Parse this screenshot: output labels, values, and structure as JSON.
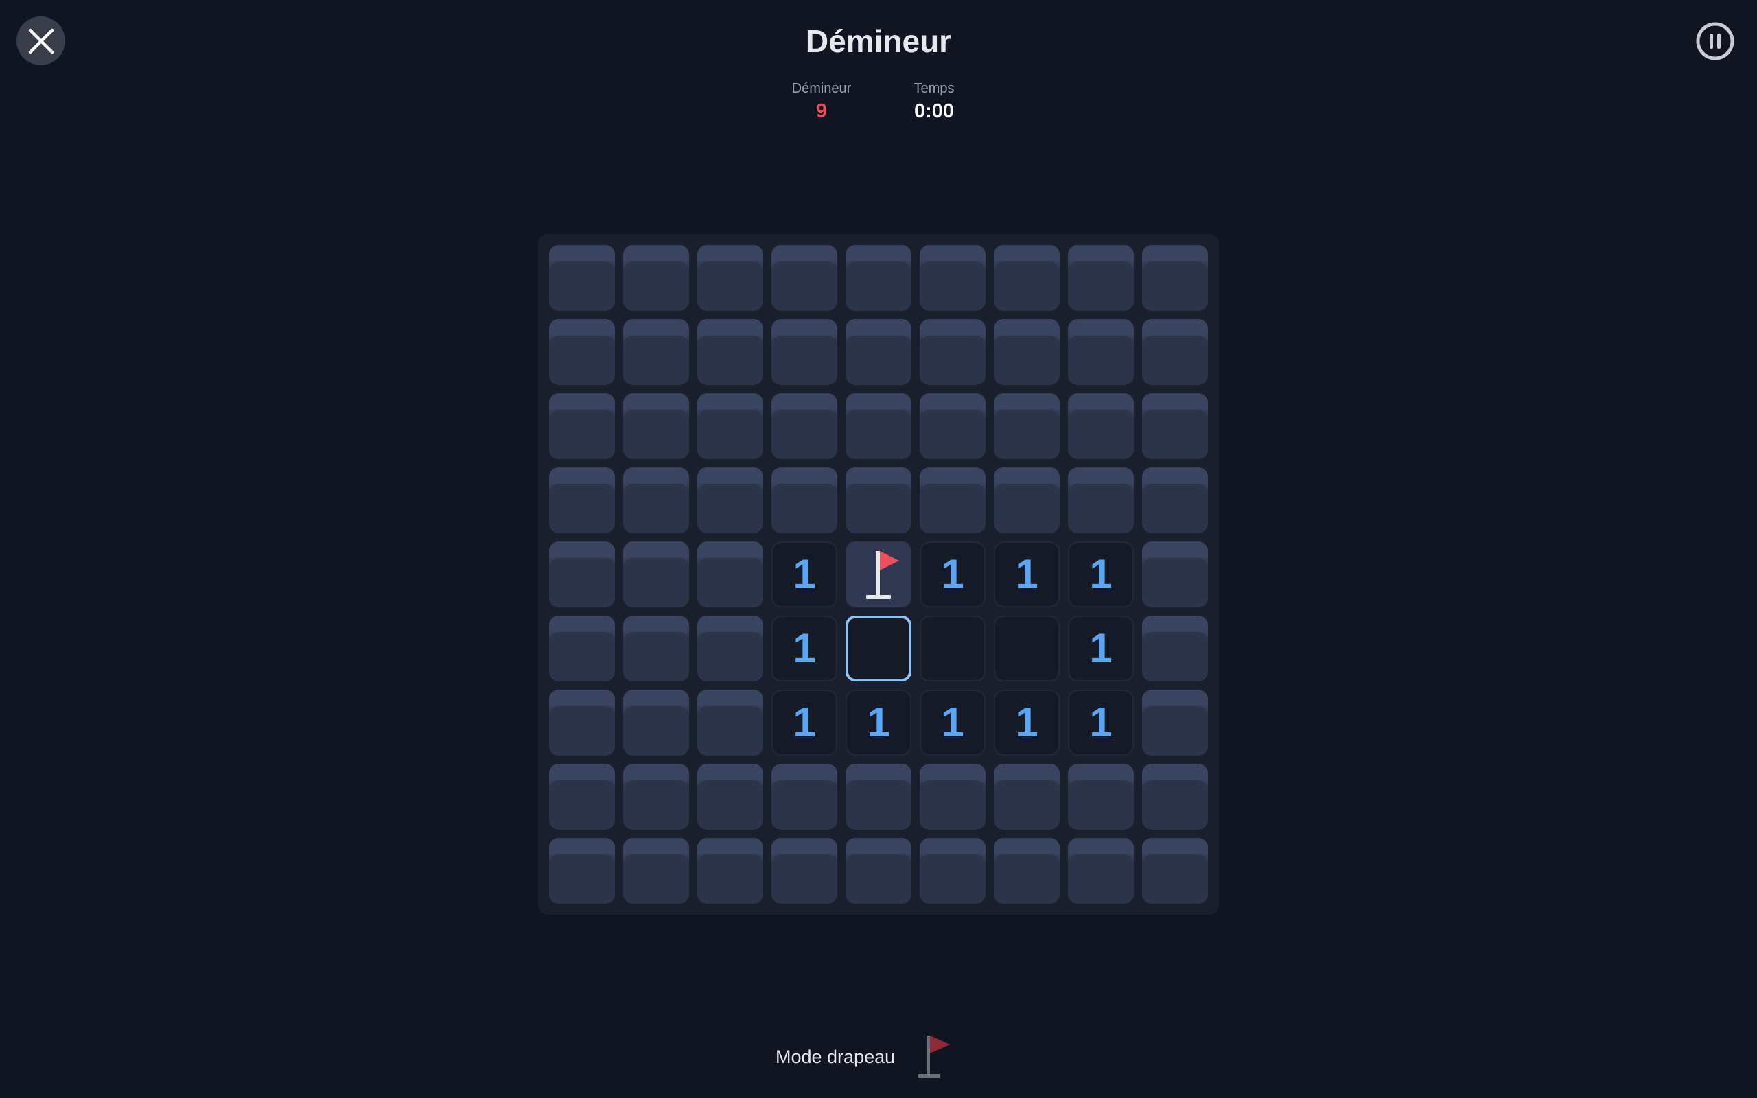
{
  "header": {
    "title": "Démineur"
  },
  "stats": {
    "mines_label": "Démineur",
    "mines_value": "9",
    "time_label": "Temps",
    "time_value": "0:00"
  },
  "board": {
    "rows": 9,
    "cols": 9,
    "cells": [
      [
        "h",
        "h",
        "h",
        "h",
        "h",
        "h",
        "h",
        "h",
        "h"
      ],
      [
        "h",
        "h",
        "h",
        "h",
        "h",
        "h",
        "h",
        "h",
        "h"
      ],
      [
        "h",
        "h",
        "h",
        "h",
        "h",
        "h",
        "h",
        "h",
        "h"
      ],
      [
        "h",
        "h",
        "h",
        "h",
        "h",
        "h",
        "h",
        "h",
        "h"
      ],
      [
        "h",
        "h",
        "h",
        "1",
        "F",
        "1",
        "1",
        "1",
        "h"
      ],
      [
        "h",
        "h",
        "h",
        "1",
        "S",
        "0",
        "0",
        "1",
        "h"
      ],
      [
        "h",
        "h",
        "h",
        "1",
        "1",
        "1",
        "1",
        "1",
        "h"
      ],
      [
        "h",
        "h",
        "h",
        "h",
        "h",
        "h",
        "h",
        "h",
        "h"
      ],
      [
        "h",
        "h",
        "h",
        "h",
        "h",
        "h",
        "h",
        "h",
        "h"
      ]
    ]
  },
  "footer": {
    "flag_mode_label": "Mode drapeau"
  },
  "colors": {
    "background": "#111522",
    "number": "#58a6f5",
    "flag": "#ee4f5c",
    "mines_counter": "#ee4f5c",
    "selected_border": "#8fc4f2"
  },
  "icons": {
    "close": "close-icon",
    "pause": "pause-icon",
    "flag": "flag-icon"
  }
}
